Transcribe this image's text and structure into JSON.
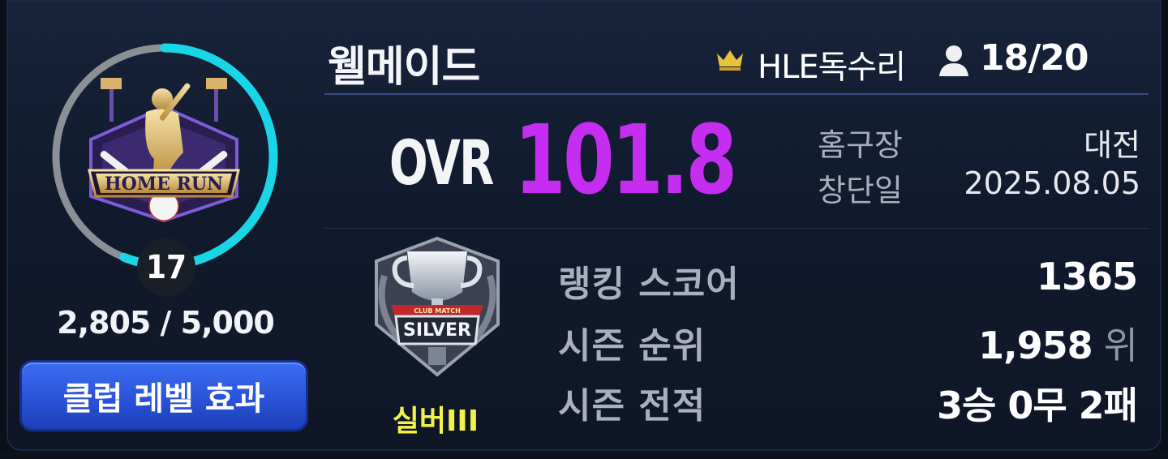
{
  "club": {
    "name": "웰메이드",
    "leader": "HLE독수리",
    "members": "18/20"
  },
  "level": {
    "value": "17",
    "exp_text": "2,805 / 5,000",
    "progress": 0.561,
    "emblem_text": "HOME RUN",
    "button_label": "클럽 레벨 효과"
  },
  "ovr": {
    "label": "OVR",
    "value": "101.8"
  },
  "info": {
    "home_label": "홈구장",
    "home_value": "대전",
    "founded_label": "창단일",
    "founded_value": "2025.08.05"
  },
  "league": {
    "badge_text": "SILVER",
    "badge_subtext": "CLUB MATCH",
    "tier": "실버III"
  },
  "stats": {
    "ranking_label": "랭킹 스코어",
    "ranking_value": "1365",
    "rank_label": "시즌 순위",
    "rank_value": "1,958",
    "rank_unit": "위",
    "record_label": "시즌 전적",
    "record_value": "3승 0무 2패"
  },
  "colors": {
    "ovr": "#c52ef0",
    "progress": "#19d6e6",
    "tier": "#f2f34a",
    "button": "#2a52d8",
    "crown": "#e8c23a"
  },
  "icons": [
    "crown-icon",
    "person-icon",
    "homerun-emblem",
    "silver-trophy-icon"
  ]
}
